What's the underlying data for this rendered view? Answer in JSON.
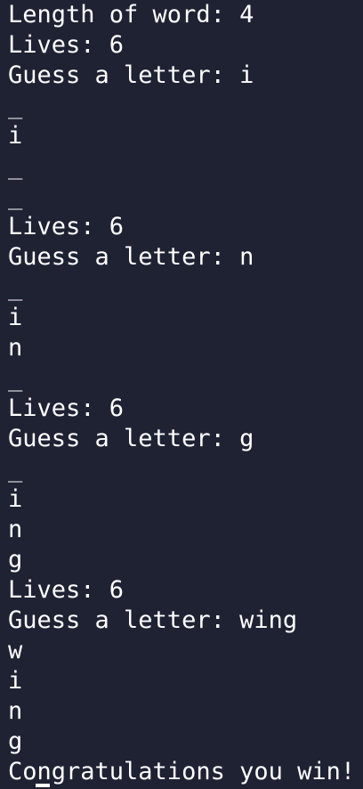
{
  "terminal": {
    "lines": [
      "Length of word: 4",
      "Lives: 6",
      "Guess a letter: i",
      "",
      "_",
      "i",
      "",
      "_",
      "",
      "_",
      "Lives: 6",
      "Guess a letter: n",
      "",
      "_",
      "i",
      "n",
      "",
      "_",
      "Lives: 6",
      "Guess a letter: g",
      "",
      "_",
      "i",
      "n",
      "g",
      "Lives: 6",
      "Guess a letter: wing",
      "w",
      "i",
      "n",
      "g",
      "Congratulations you win!"
    ]
  }
}
